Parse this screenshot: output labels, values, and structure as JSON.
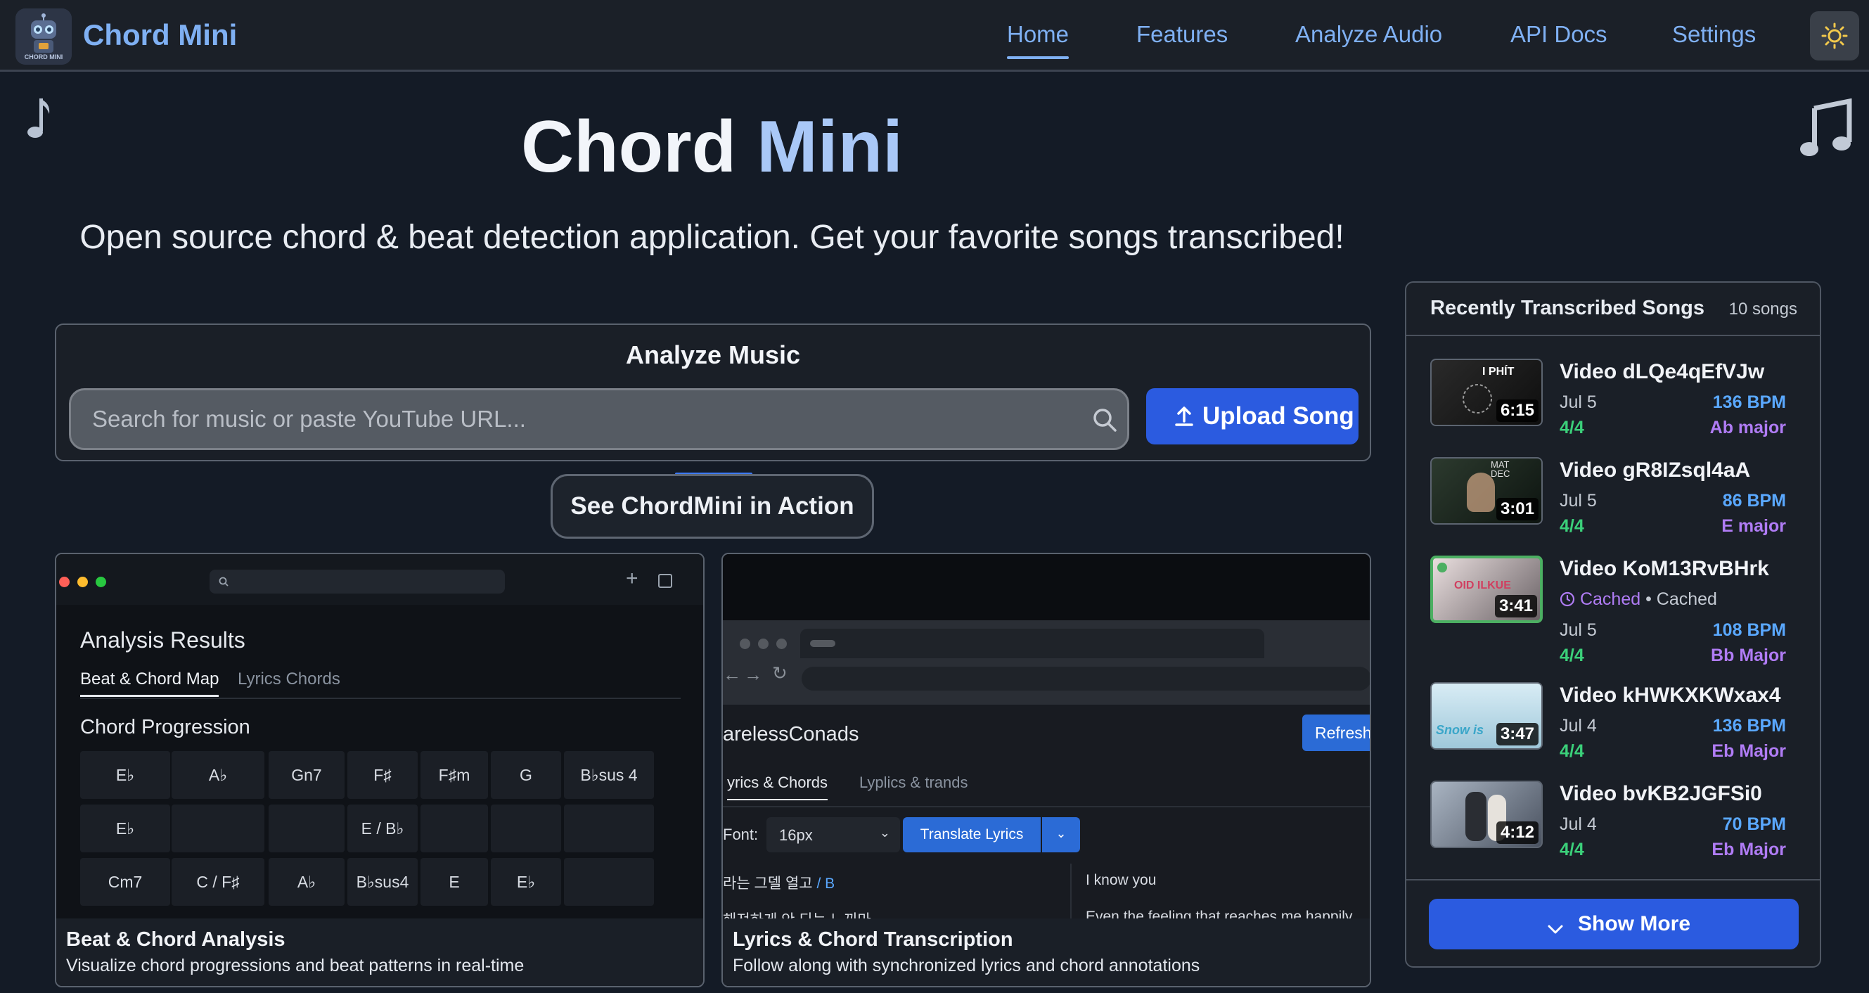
{
  "navbar": {
    "brand": "Chord Mini",
    "logo_text": "CHORD MINI",
    "links": [
      "Home",
      "Features",
      "Analyze Audio",
      "API Docs",
      "Settings"
    ],
    "active": "Home",
    "theme_icon": "sun-icon"
  },
  "hero": {
    "title_part1": "Chord",
    "title_part2": "Mini",
    "subtitle": "Open source chord & beat detection application. Get your favorite songs transcribed!"
  },
  "analyze": {
    "title": "Analyze Music",
    "search_placeholder": "Search for music or paste YouTube URL...",
    "upload_label": "Upload Song",
    "see_action_label": "See ChordMini in Action"
  },
  "demo_beat": {
    "heading": "Analysis Results",
    "tab_active": "Beat & Chord Map",
    "tab_inactive": "Lyrics Chords",
    "section": "Chord Progression",
    "row1": [
      "E♭",
      "A♭",
      "Gn7",
      "F♯",
      "F♯m",
      "G",
      "B♭sus 4"
    ],
    "row2": [
      "E♭",
      "",
      "",
      "E / B♭",
      "",
      "",
      ""
    ],
    "row3": [
      "Cm7",
      "C / F♯",
      "A♭",
      "B♭sus4",
      "E",
      "E♭",
      ""
    ],
    "caption_title": "Beat & Chord Analysis",
    "caption_desc": "Visualize chord progressions and beat patterns in real-time"
  },
  "demo_lyrics": {
    "channel": "arelessConads",
    "refresh": "Refresh",
    "tab_active": "yrics & Chords",
    "tab_inactive": "Lyplics & trands",
    "font_label": "Font:",
    "font_value": "16px",
    "translate_label": "Translate Lyrics",
    "lyric_kr_1": "라는 그델 열고",
    "lyric_kr_chord": "/ B",
    "lyric_kr_2": "해져하게 안 되는 느끼마",
    "lyric_en_1": "I know you",
    "lyric_en_2": "Even the feeling that reaches me happily",
    "caption_title": "Lyrics & Chord Transcription",
    "caption_desc": "Follow along with synchronized lyrics and chord annotations"
  },
  "recent": {
    "title": "Recently Transcribed Songs",
    "count": "10 songs",
    "songs": [
      {
        "title": "Video dLQe4qEfVJw",
        "date": "Jul 5",
        "time": "4/4",
        "bpm": "136 BPM",
        "key": "Ab major",
        "duration": "6:15",
        "thumb_text": "I PHÍT"
      },
      {
        "title": "Video gR8IZsql4aA",
        "date": "Jul 5",
        "time": "4/4",
        "bpm": "86 BPM",
        "key": "E major",
        "duration": "3:01",
        "thumb_text": "MAT DEC"
      },
      {
        "title": "Video KoM13RvBHrk",
        "cached_label": "Cached",
        "cached_plain": "Cached",
        "date": "Jul 5",
        "time": "4/4",
        "bpm": "108 BPM",
        "key": "Bb Major",
        "duration": "3:41",
        "thumb_text": "OID ILKUE"
      },
      {
        "title": "Video kHWKXKWxax4",
        "date": "Jul 4",
        "time": "4/4",
        "bpm": "136 BPM",
        "key": "Eb Major",
        "duration": "3:47",
        "thumb_text": "Snow is"
      },
      {
        "title": "Video bvKB2JGFSi0",
        "date": "Jul 4",
        "time": "4/4",
        "bpm": "70 BPM",
        "key": "Eb Major",
        "duration": "4:12",
        "thumb_text": ""
      }
    ],
    "show_more": "Show More"
  },
  "colors": {
    "accent_blue": "#2b5be0",
    "link_blue": "#7fb0f3",
    "bpm_blue": "#5aa8ff",
    "time_green": "#3bd07a",
    "key_purple": "#b07cf5"
  }
}
